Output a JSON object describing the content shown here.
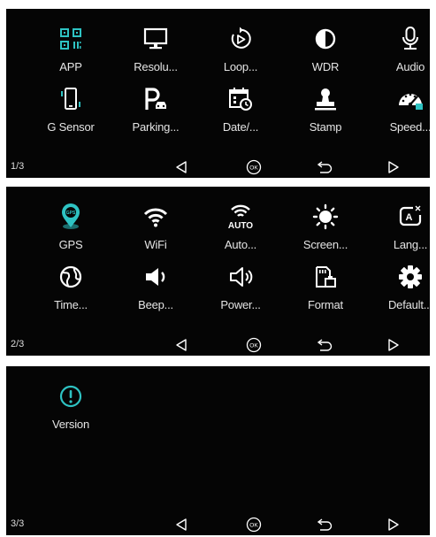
{
  "colors": {
    "accent": "#2ec3c3",
    "icon": "#ffffff",
    "label": "#e4e4e4",
    "background": "#050505"
  },
  "pages": [
    {
      "indicator": "1/3",
      "items": [
        {
          "label": "APP",
          "icon": "qr-code-icon"
        },
        {
          "label": "Resolu...",
          "icon": "monitor-icon"
        },
        {
          "label": "Loop...",
          "icon": "loop-recording-icon"
        },
        {
          "label": "WDR",
          "icon": "wdr-contrast-icon"
        },
        {
          "label": "Audio",
          "icon": "microphone-icon"
        },
        {
          "label": "G Sensor",
          "icon": "g-sensor-icon"
        },
        {
          "label": "Parking...",
          "icon": "parking-icon"
        },
        {
          "label": "Date/...",
          "icon": "calendar-clock-icon"
        },
        {
          "label": "Stamp",
          "icon": "stamp-icon"
        },
        {
          "label": "Speed...",
          "icon": "speedometer-icon"
        }
      ]
    },
    {
      "indicator": "2/3",
      "items": [
        {
          "label": "GPS",
          "icon": "gps-pin-icon"
        },
        {
          "label": "WiFi",
          "icon": "wifi-icon"
        },
        {
          "label": "Auto...",
          "icon": "auto-wifi-icon",
          "icon_text": "AUTO"
        },
        {
          "label": "Screen...",
          "icon": "screen-brightness-icon"
        },
        {
          "label": "Lang...",
          "icon": "language-icon",
          "icon_text": "A"
        },
        {
          "label": "Time...",
          "icon": "timezone-globe-icon"
        },
        {
          "label": "Beep...",
          "icon": "speaker-icon"
        },
        {
          "label": "Power...",
          "icon": "power-speaker-icon"
        },
        {
          "label": "Format",
          "icon": "sd-card-format-icon"
        },
        {
          "label": "Default...",
          "icon": "gear-icon"
        }
      ]
    },
    {
      "indicator": "3/3",
      "items": [
        {
          "label": "Version",
          "icon": "info-exclamation-icon"
        }
      ]
    }
  ],
  "nav": {
    "prev_icon": "triangle-left-icon",
    "ok_icon": "ok-circle-icon",
    "ok_text": "OK",
    "back_icon": "return-arrow-icon",
    "next_icon": "triangle-right-icon"
  }
}
